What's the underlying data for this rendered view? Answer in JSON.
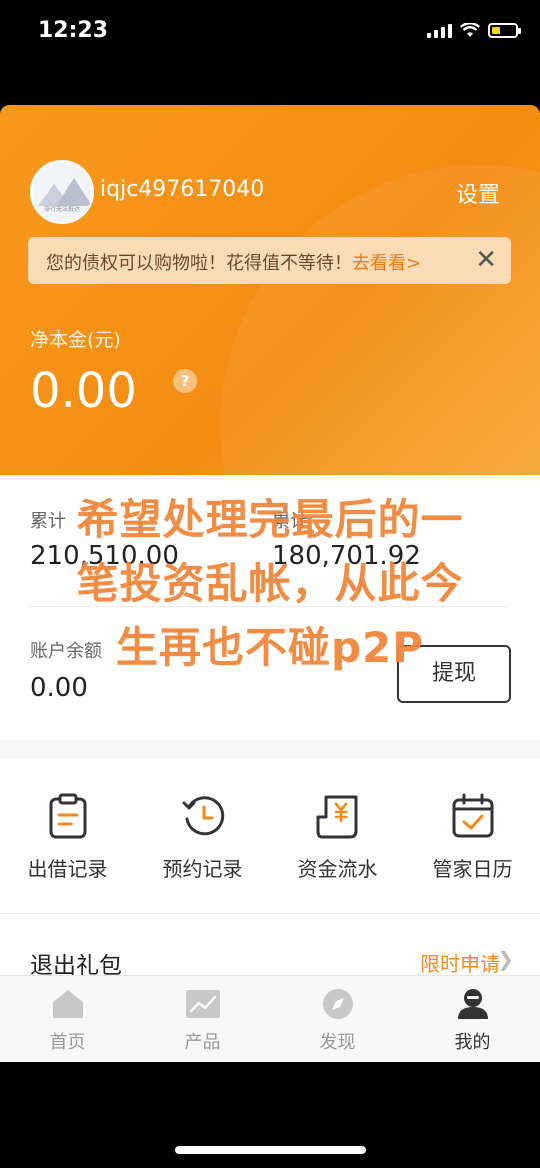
{
  "status_bar": {
    "time": "12:23"
  },
  "profile": {
    "username": "iqjc497617040",
    "settings_label": "设置",
    "avatar_caption": "旅行无法抵达"
  },
  "notice": {
    "text": "您的债权可以购物啦！花得值不等待！",
    "link": "去看看>",
    "close": "✕"
  },
  "principal": {
    "label": "净本金(元)",
    "value": "0.00",
    "help": "?"
  },
  "stats": {
    "cumulative_1": {
      "label": "累计",
      "value": "210,510.00"
    },
    "cumulative_2": {
      "label": "累计",
      "value": "180,701.92"
    },
    "balance": {
      "label": "账户余额",
      "value": "0.00"
    },
    "withdraw_label": "提现"
  },
  "overlay_text": [
    "希望处理完最后的一",
    "笔投资乱帐，从此今",
    "生再也不碰p2P"
  ],
  "quick_actions": [
    {
      "label": "出借记录",
      "icon": "clipboard-icon"
    },
    {
      "label": "预约记录",
      "icon": "clock-history-icon"
    },
    {
      "label": "资金流水",
      "icon": "money-receipt-icon"
    },
    {
      "label": "管家日历",
      "icon": "calendar-check-icon"
    }
  ],
  "exit_gift": {
    "title": "退出礼包",
    "apply": "限时申请"
  },
  "tabs": [
    {
      "label": "首页",
      "icon": "home-icon"
    },
    {
      "label": "产品",
      "icon": "chart-icon"
    },
    {
      "label": "发现",
      "icon": "compass-icon"
    },
    {
      "label": "我的",
      "icon": "user-icon",
      "active": true
    }
  ],
  "colors": {
    "brand_orange": "#f48c12",
    "accent_orange": "#f58a1c"
  }
}
